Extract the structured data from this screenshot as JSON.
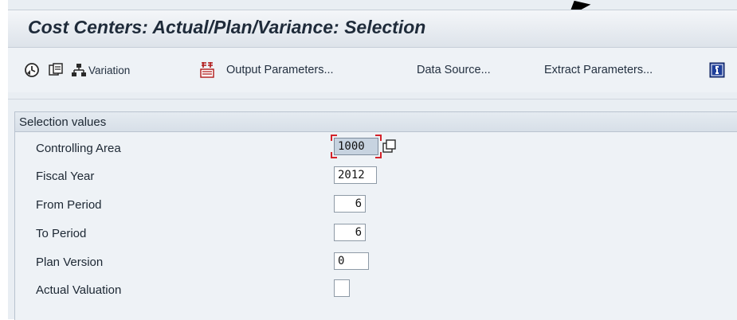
{
  "window": {
    "title": "Cost Centers: Actual/Plan/Variance: Selection"
  },
  "toolbar": {
    "execute_icon": "execute-clock-icon",
    "copy_icon": "save-variant-icon",
    "variation_icon": "hierarchy-icon",
    "variation_label": "Variation",
    "output_icon": "output-parameters-icon",
    "output_label": "Output Parameters...",
    "data_source_label": "Data Source...",
    "extract_label": "Extract Parameters...",
    "info_icon": "info-icon"
  },
  "selection": {
    "group_title": "Selection values",
    "fields": [
      {
        "label": "Controlling Area",
        "value": "1000"
      },
      {
        "label": "Fiscal Year",
        "value": "2012"
      },
      {
        "label": "From Period",
        "value": "6"
      },
      {
        "label": "To Period",
        "value": "6"
      },
      {
        "label": "Plan Version",
        "value": "0"
      },
      {
        "label": "Actual Valuation",
        "value": ""
      }
    ]
  },
  "colors": {
    "title_bar": "#dde3ea",
    "panel": "#eef2f6",
    "focus_marker": "#d4232b",
    "info_icon_blue": "#1f3f9a"
  }
}
